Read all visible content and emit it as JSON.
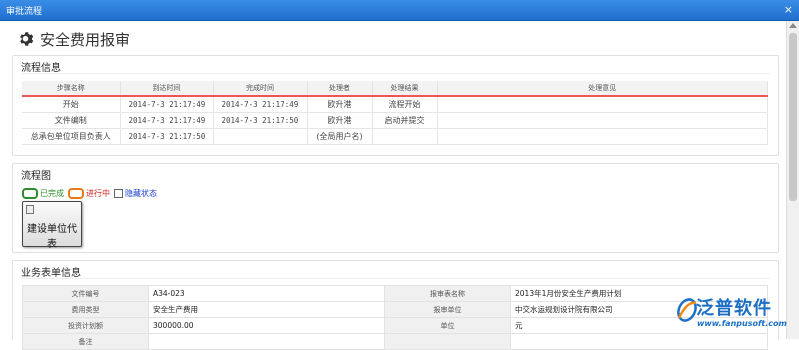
{
  "window": {
    "title": "审批流程"
  },
  "page": {
    "title": "安全费用报审"
  },
  "workflow": {
    "title": "流程信息",
    "headers": [
      "步骤名称",
      "到达时间",
      "完成时间",
      "处理者",
      "处理结果",
      "处理意见"
    ],
    "rows": [
      [
        "开始",
        "2014-7-3 21:17:49",
        "2014-7-3 21:17:49",
        "欧升港",
        "流程开始",
        ""
      ],
      [
        "文件编制",
        "2014-7-3 21:17:49",
        "2014-7-3 21:17:50",
        "欧升港",
        "启动并提交",
        ""
      ],
      [
        "总承包单位项目负责人",
        "2014-7-3 21:17:50",
        "",
        "(全局用户名)",
        "",
        ""
      ]
    ]
  },
  "flowchart": {
    "title": "流程图",
    "legend": {
      "done": "已完成",
      "active": "进行中",
      "hide": "隐藏状态"
    },
    "node_label": "建设单位代表",
    "colors": {
      "done": "#2e8b2e",
      "active": "#e87a1c",
      "hide": "#1a3fd0"
    }
  },
  "form": {
    "title": "业务表单信息",
    "rows": [
      [
        "文件编号",
        "A34-023",
        "报审表名称",
        "2013年1月份安全生产费用计划"
      ],
      [
        "费用类型",
        "安全生产费用",
        "报审单位",
        "中交水运规划设计院有限公司"
      ],
      [
        "投资计划额",
        "300000.00",
        "单位",
        "元"
      ],
      [
        "备注",
        "",
        "",
        ""
      ]
    ]
  },
  "brand": {
    "name": "泛普软件",
    "url": "www.fanpusoft.com"
  },
  "colors": {
    "titlebar": "#2b7fd9",
    "accent_red": "#e55555",
    "brand_blue": "#1b6fc4"
  },
  "icons": {
    "page": "gear-icon",
    "close": "close-icon",
    "node": "document-icon"
  }
}
